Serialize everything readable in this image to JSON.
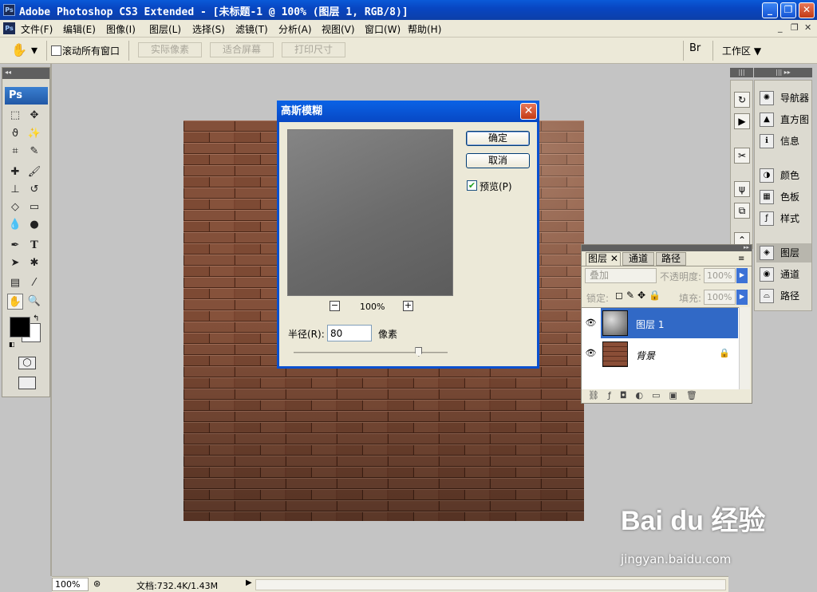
{
  "window": {
    "title": "Adobe Photoshop CS3 Extended - [未标题-1 @ 100% (图层 1, RGB/8)]",
    "app_icon": "Ps",
    "minimize": "_",
    "maximize": "❐",
    "close": "✕"
  },
  "menu": {
    "items": [
      "文件(F)",
      "编辑(E)",
      "图像(I)",
      "图层(L)",
      "选择(S)",
      "滤镜(T)",
      "分析(A)",
      "视图(V)",
      "窗口(W)",
      "帮助(H)"
    ],
    "doc_min": "_",
    "doc_restore": "❐",
    "doc_close": "✕"
  },
  "options": {
    "scroll_all": "滚动所有窗口",
    "actual_pixels": "实际像素",
    "fit_screen": "适合屏幕",
    "print_size": "打印尺寸",
    "workspace": "工作区 ▼"
  },
  "toolbox": {
    "logo": "Ps"
  },
  "dialog": {
    "title": "高斯模糊",
    "ok": "确定",
    "cancel": "取消",
    "preview_label": "预览(P)",
    "preview_checked": true,
    "zoom": "100%",
    "radius_label": "半径(R):",
    "radius_value": "80",
    "unit": "像素",
    "radius_slider_fraction": 0.81
  },
  "layers_panel": {
    "tabs": [
      "图层",
      "通道",
      "路径"
    ],
    "blend_mode": "叠加",
    "opacity_label": "不透明度:",
    "opacity_value": "100%",
    "lock_label": "锁定:",
    "fill_label": "填充:",
    "fill_value": "100%",
    "layers": [
      {
        "name": "图层 1",
        "selected": true
      },
      {
        "name": "背景",
        "locked": true
      }
    ]
  },
  "right_panels": [
    {
      "label": "导航器",
      "icon": "navigator-icon"
    },
    {
      "label": "直方图",
      "icon": "histogram-icon"
    },
    {
      "label": "信息",
      "icon": "info-icon"
    },
    {
      "label": "颜色",
      "icon": "color-icon"
    },
    {
      "label": "色板",
      "icon": "swatches-icon"
    },
    {
      "label": "样式",
      "icon": "styles-icon"
    },
    {
      "label": "图层",
      "icon": "layers-icon"
    },
    {
      "label": "通道",
      "icon": "channels-icon"
    },
    {
      "label": "路径",
      "icon": "paths-icon"
    }
  ],
  "statusbar": {
    "zoom": "100%",
    "doc_info": "文档:732.4K/1.43M"
  },
  "watermark": {
    "brand": "Bai du 经验",
    "url": "jingyan.baidu.com"
  },
  "colors": {
    "title_blue": "#0a5ad8",
    "brick": "#6e3b26",
    "selected_layer": "#3169c6"
  }
}
